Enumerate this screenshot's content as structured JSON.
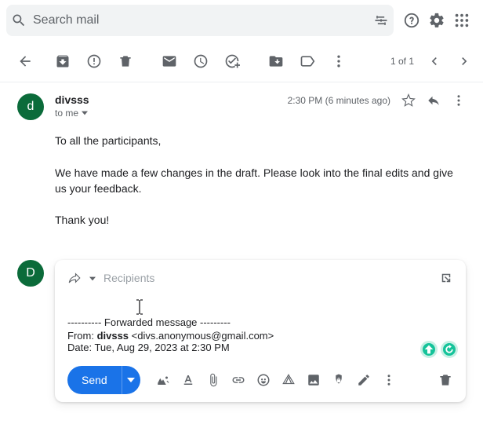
{
  "search": {
    "placeholder": "Search mail"
  },
  "toolbar": {
    "count": "1 of 1"
  },
  "mail": {
    "sender": "divsss",
    "to": "to me",
    "time": "2:30 PM (6 minutes ago)",
    "body": "To all the participants,\n\nWe have made a few changes in the draft. Please look into the final edits and give us your feedback.\n\nThank you!"
  },
  "reply": {
    "avatar_letter": "D",
    "mail_avatar_letter": "d",
    "recipients_placeholder": "Recipients",
    "fwd_sep": "---------- Forwarded message ---------",
    "fwd_from_label": "From: ",
    "fwd_from_name": "divsss",
    "fwd_from_addr": " <divs.anonymous@gmail.com>",
    "fwd_date": "Date: Tue, Aug 29, 2023 at 2:30 PM",
    "send_label": "Send"
  }
}
